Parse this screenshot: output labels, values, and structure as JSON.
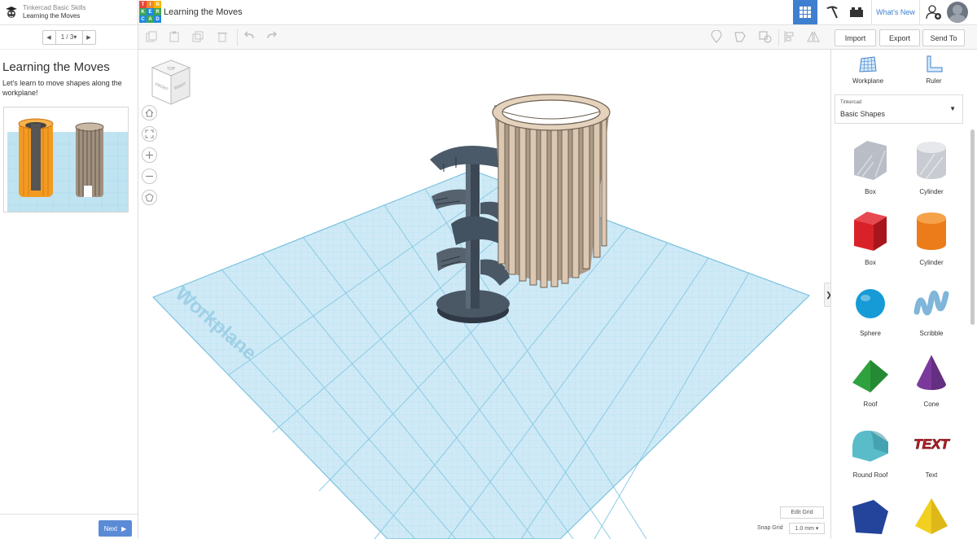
{
  "lesson": {
    "course": "Tinkercad Basic Skills",
    "name": "Learning the Moves",
    "pager": {
      "count": "1 / 3",
      "dropdown": "▾"
    },
    "title": "Learning the Moves",
    "description": "Let's learn to move shapes along the workplane!",
    "next_label": "Next"
  },
  "header": {
    "logo_letters": [
      "T",
      "I",
      "N",
      "K",
      "E",
      "R",
      "C",
      "A",
      "D"
    ],
    "logo_colors": [
      "#e8443a",
      "#ef8a28",
      "#f4b400",
      "#3ca552",
      "#1e88e5",
      "#3ca552",
      "#1e88e5",
      "#3ca552",
      "#1e88e5"
    ],
    "design_title": "Learning the Moves",
    "whats_new": "What's New"
  },
  "toolbar": {
    "import_label": "Import",
    "export_label": "Export",
    "send_to_label": "Send To"
  },
  "viewport": {
    "workplane_label": "Workplane",
    "view_cube": {
      "top": "TOP",
      "front": "FRONT",
      "right": "RIGHT"
    },
    "edit_grid_label": "Edit Grid",
    "snap_grid_label": "Snap Grid",
    "snap_grid_value": "1.0 mm ▾"
  },
  "right_panel": {
    "workplane_label": "Workplane",
    "ruler_label": "Ruler",
    "library_small": "Tinkercad",
    "library_name": "Basic Shapes",
    "shapes": [
      {
        "label": "Box",
        "color": "#b9bec6"
      },
      {
        "label": "Cylinder",
        "color": "#c8ccd2"
      },
      {
        "label": "Box",
        "color": "#d9212a"
      },
      {
        "label": "Cylinder",
        "color": "#ec7b1a"
      },
      {
        "label": "Sphere",
        "color": "#169bd6"
      },
      {
        "label": "Scribble",
        "color": "#7fb6d9"
      },
      {
        "label": "Roof",
        "color": "#2fa23f"
      },
      {
        "label": "Cone",
        "color": "#7b3a9b"
      },
      {
        "label": "Round Roof",
        "color": "#5bbcc9"
      },
      {
        "label": "Text",
        "color": "#c0202a"
      },
      {
        "label": "",
        "color": "#23449a"
      },
      {
        "label": "",
        "color": "#f2d021"
      }
    ],
    "text_shape_word": "TEXT"
  }
}
